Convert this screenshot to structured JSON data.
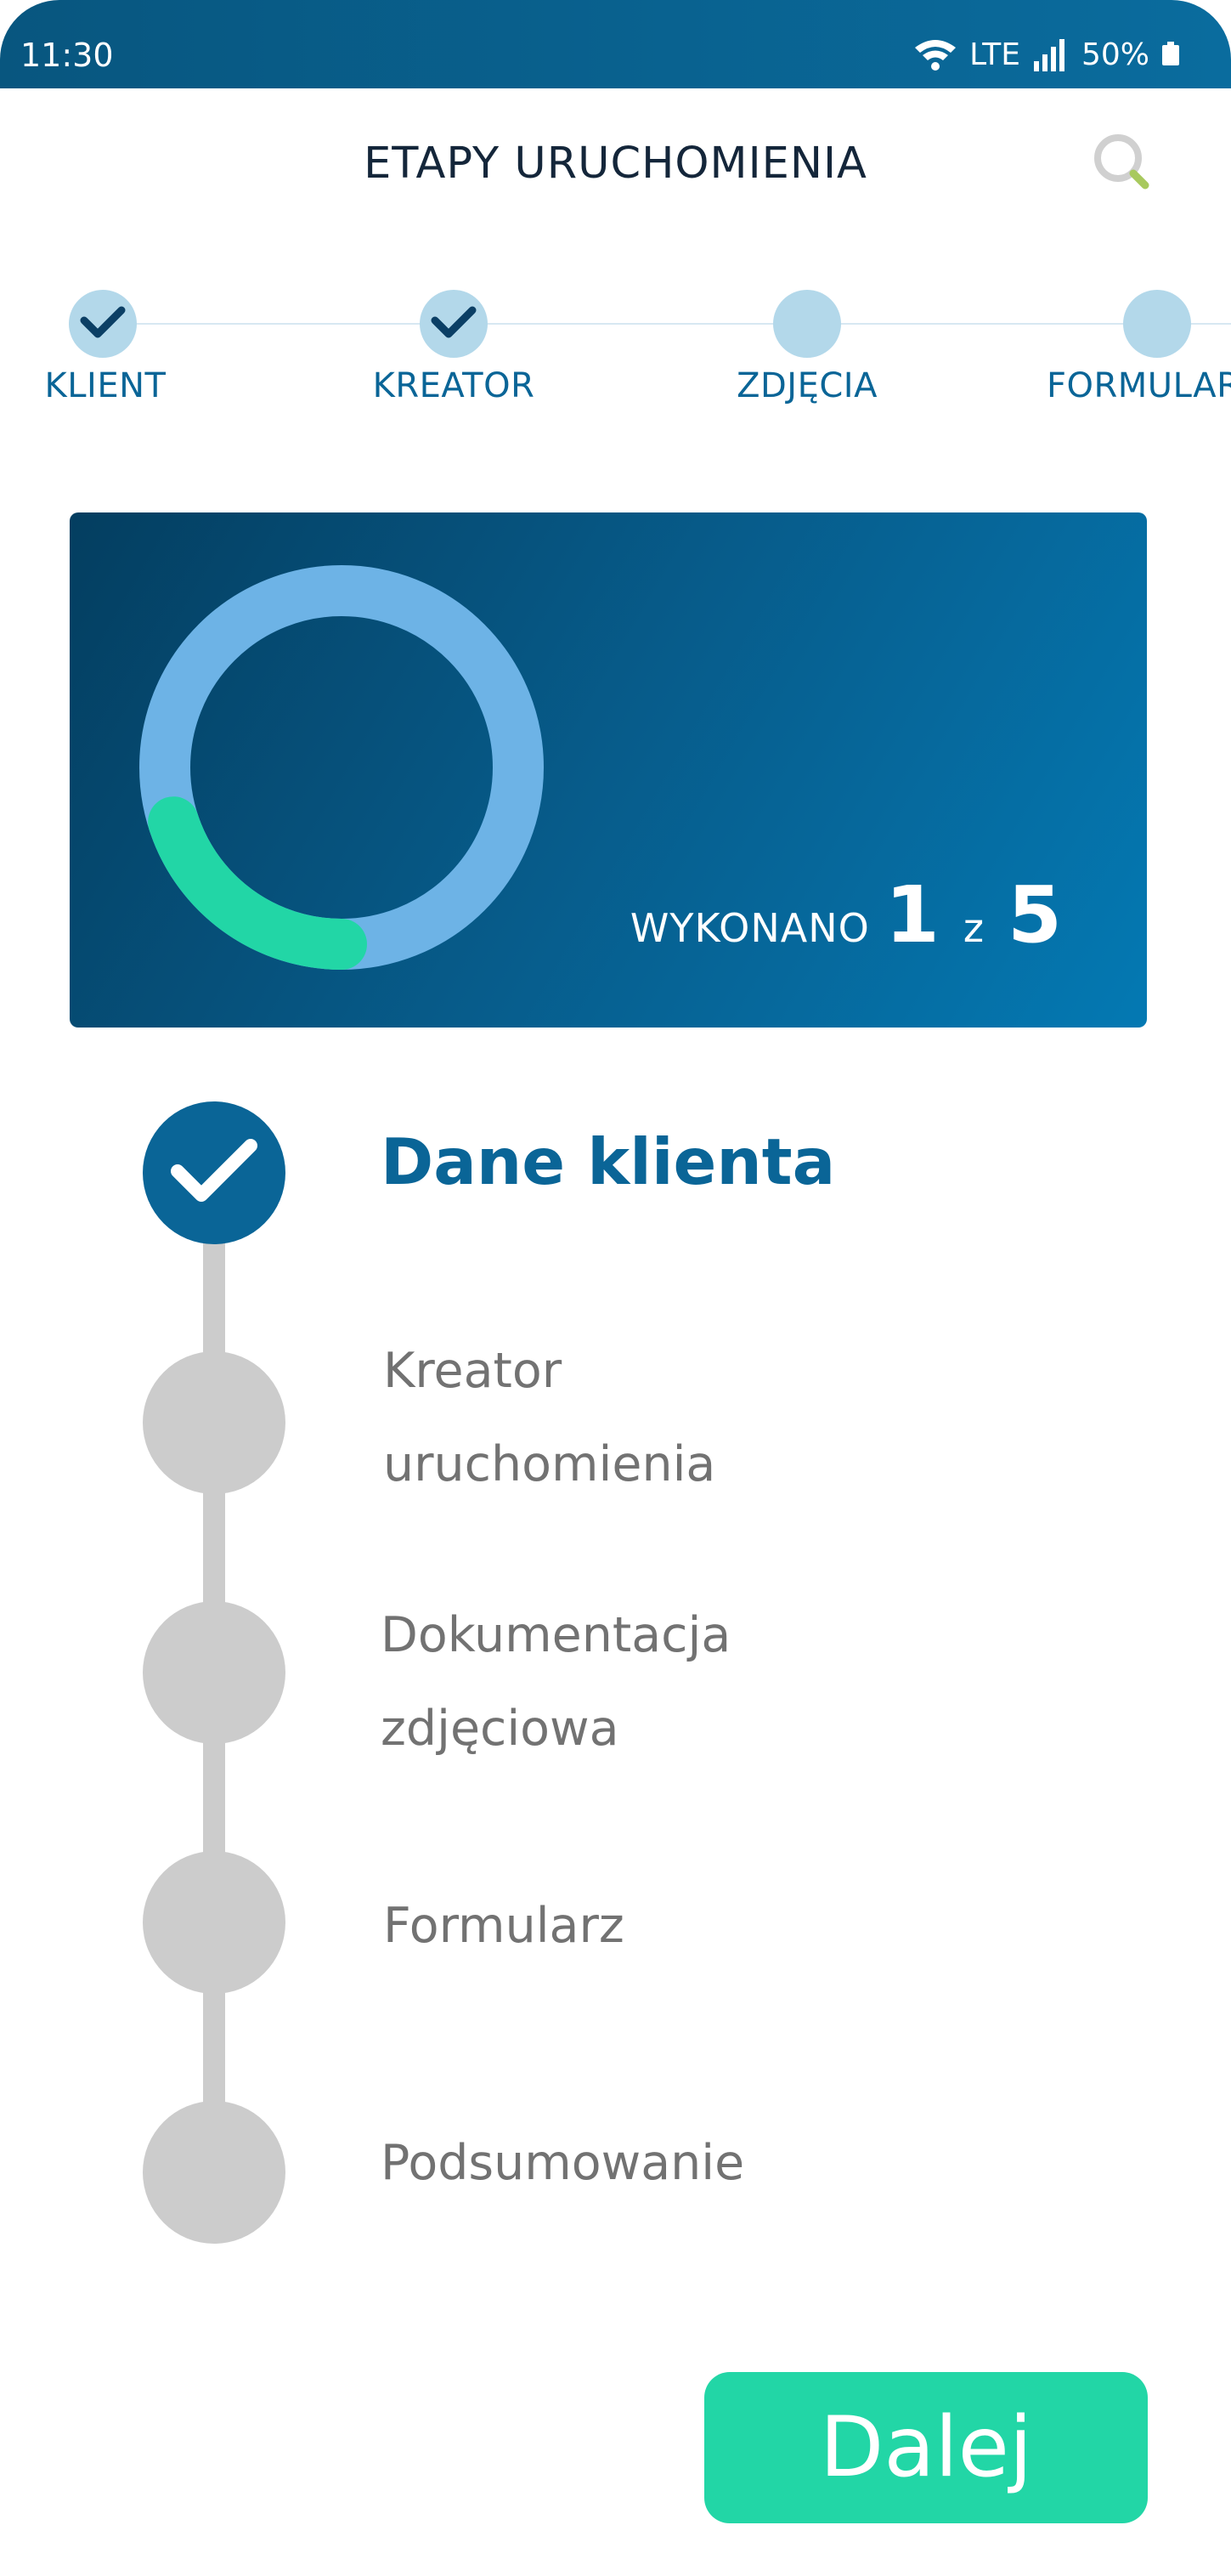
{
  "status_bar": {
    "time": "11:30",
    "network": "LTE",
    "battery": "50%"
  },
  "header": {
    "title": "ETAPY URUCHOMIENIA",
    "search_icon": "search-icon"
  },
  "stepper": {
    "steps": [
      {
        "label": "KLIENT",
        "done": true
      },
      {
        "label": "KREATOR",
        "done": true
      },
      {
        "label": "ZDJĘCIA",
        "done": false
      },
      {
        "label": "FORMULARZ",
        "done": false
      }
    ]
  },
  "progress": {
    "label": "WYKONANO",
    "completed": "1",
    "separator": "z",
    "total": "5",
    "fraction": 0.2,
    "colors": {
      "track": "#6db3e6",
      "fill": "#22d6a6"
    }
  },
  "timeline": {
    "items": [
      {
        "label": "Dane klienta",
        "done": true
      },
      {
        "label": "Kreator uruchomienia",
        "line1": "Kreator",
        "line2": "uruchomienia",
        "done": false
      },
      {
        "label": "Dokumentacja zdjęciowa",
        "line1": "Dokumentacja",
        "line2": "zdjęciowa",
        "done": false
      },
      {
        "label": "Formularz",
        "done": false
      },
      {
        "label": "Podsumowanie",
        "done": false
      }
    ]
  },
  "next_button": {
    "label": "Dalej"
  },
  "colors": {
    "primary": "#0a6597",
    "accent": "#22d6a6",
    "inactive": "#cccccc"
  }
}
